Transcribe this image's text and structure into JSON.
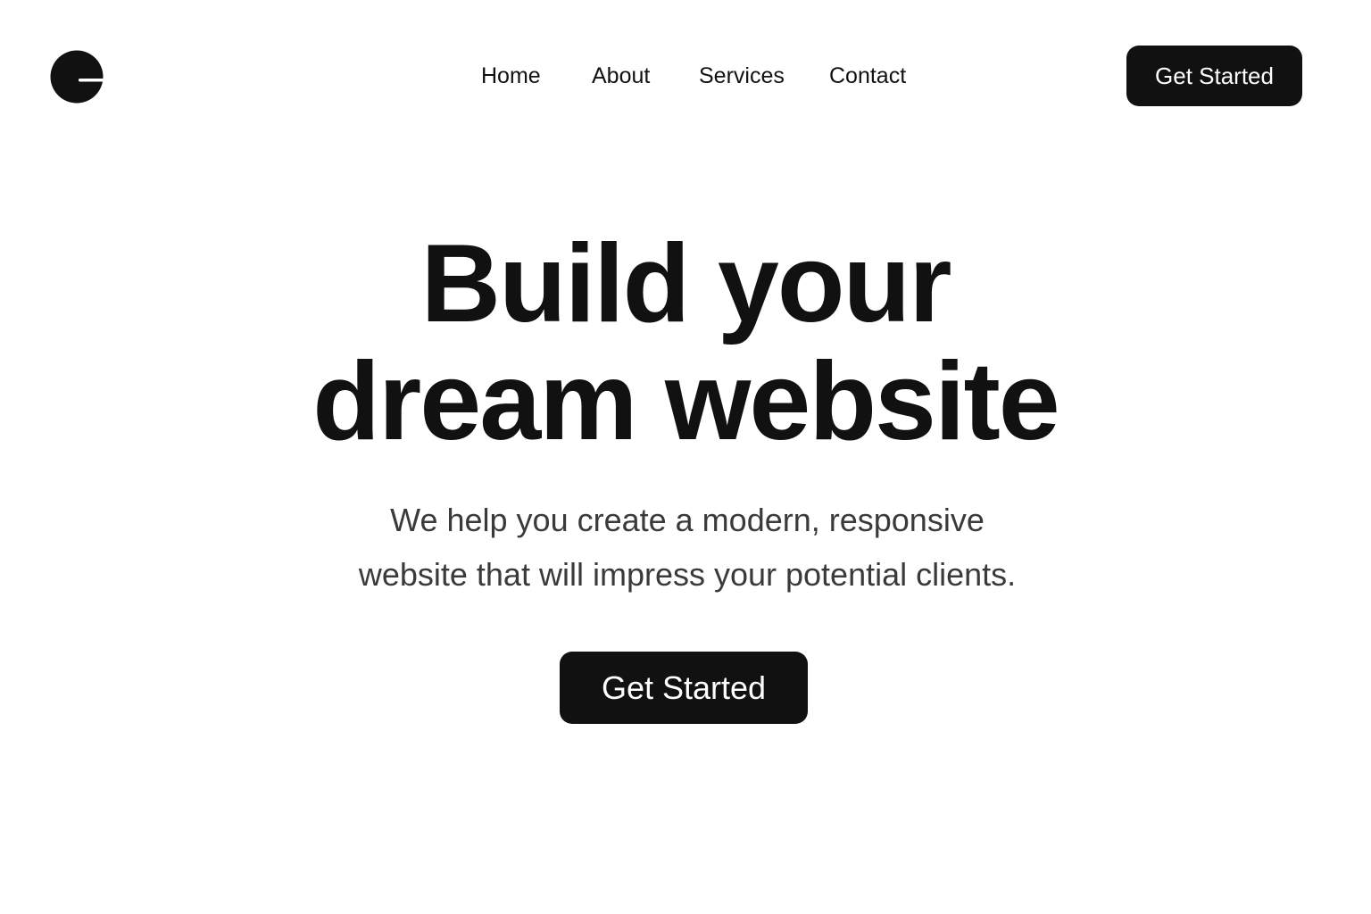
{
  "nav": {
    "logo_icon": "circle-slit-logo",
    "items": [
      {
        "label": "Home"
      },
      {
        "label": "About"
      },
      {
        "label": "Services"
      },
      {
        "label": "Contact"
      }
    ],
    "cta_label": "Get Started"
  },
  "hero": {
    "title_line1": "Build your",
    "title_line2": "dream website",
    "subtitle_line1": "We help you create a modern, responsive",
    "subtitle_line2": "website that will impress your potential clients.",
    "cta_label": "Get Started"
  },
  "colors": {
    "primary": "#111111",
    "background": "#ffffff",
    "text_secondary": "#3a3a3a"
  }
}
